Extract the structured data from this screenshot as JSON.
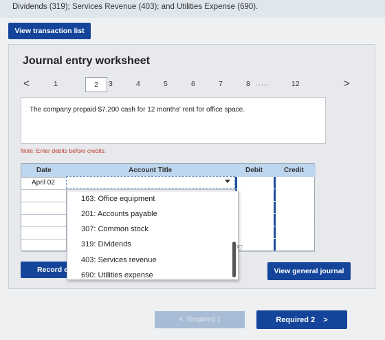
{
  "top_text": "Dividends (319); Services Revenue (403); and Utilities Expense (690).",
  "view_transaction_label": "View transaction list",
  "worksheet": {
    "title": "Journal entry worksheet",
    "pages": [
      "1",
      "2",
      "3",
      "4",
      "5",
      "6",
      "7",
      "8"
    ],
    "page_ellipsis": ".....",
    "last_page": "12",
    "active_page": "2",
    "prev_arrow": "<",
    "next_arrow": ">",
    "description": "The company prepaid $7,200 cash for 12 months' rent for office space.",
    "note": "Note: Enter debits before credits."
  },
  "journal": {
    "headers": {
      "date": "Date",
      "account": "Account Title",
      "debit": "Debit",
      "credit": "Credit"
    },
    "first_date": "April 02"
  },
  "dropdown": {
    "options": [
      "163: Office equipment",
      "201: Accounts payable",
      "307: Common stock",
      "319: Dividends",
      "403: Services revenue",
      "690: Utilities expense"
    ]
  },
  "buttons": {
    "record": "Record e",
    "view_general_journal": "View general journal",
    "required_prev": "Required 1",
    "required_next": "Required 2"
  },
  "colors": {
    "primary_blue": "#15459a",
    "header_blue": "#bed6ee",
    "note_red": "#c0392b"
  }
}
